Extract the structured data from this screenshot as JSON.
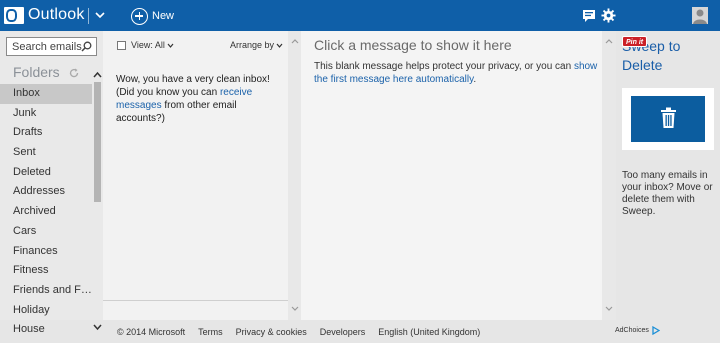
{
  "header": {
    "app_name": "Outlook",
    "new_label": "New",
    "brand_color": "#0f5fa8"
  },
  "sidebar": {
    "search_placeholder": "Search emails",
    "folders_heading": "Folders",
    "items": [
      {
        "label": "Inbox",
        "active": true
      },
      {
        "label": "Junk"
      },
      {
        "label": "Drafts"
      },
      {
        "label": "Sent"
      },
      {
        "label": "Deleted"
      },
      {
        "label": "Addresses"
      },
      {
        "label": "Archived"
      },
      {
        "label": "Cars"
      },
      {
        "label": "Finances"
      },
      {
        "label": "Fitness"
      },
      {
        "label": "Friends and Fa..."
      },
      {
        "label": "Holiday"
      },
      {
        "label": "House"
      }
    ]
  },
  "message_list": {
    "view_label": "View: All",
    "arrange_label": "Arrange by",
    "empty_text_1": "Wow, you have a very clean inbox!",
    "empty_text_2": "(Did you know you can ",
    "empty_link": "receive messages",
    "empty_text_3": " from other email accounts?)"
  },
  "reading_pane": {
    "title": "Click a message to show it here",
    "body_text": "This blank message helps protect your privacy, or you can ",
    "body_link": "show the first message here automatically",
    "body_end": "."
  },
  "ad": {
    "pin_label": "Pin it",
    "title": "Sweep to Delete",
    "text": "Too many emails in your inbox? Move or delete them with Sweep.",
    "adchoices_label": "AdChoices"
  },
  "footer": {
    "copyright": "© 2014 Microsoft",
    "terms": "Terms",
    "privacy": "Privacy & cookies",
    "developers": "Developers",
    "language": "English (United Kingdom)"
  }
}
